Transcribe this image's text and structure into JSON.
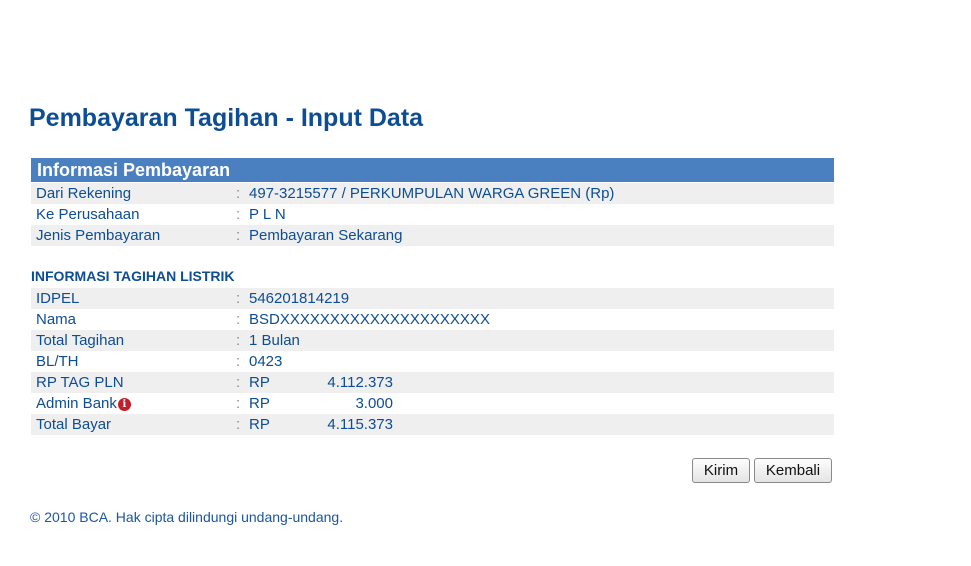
{
  "page_title": "Pembayaran Tagihan - Input Data",
  "payment_info": {
    "heading": "Informasi Pembayaran",
    "rows": [
      {
        "label": "Dari Rekening",
        "colon": ":",
        "value": "497-3215577 / PERKUMPULAN WARGA GREEN (Rp)"
      },
      {
        "label": "Ke Perusahaan",
        "colon": ":",
        "value": "P L N"
      },
      {
        "label": "Jenis Pembayaran",
        "colon": ":",
        "value": "Pembayaran Sekarang"
      }
    ]
  },
  "bill_info": {
    "heading": "INFORMASI TAGIHAN LISTRIK",
    "rows": [
      {
        "label": "IDPEL",
        "colon": ":",
        "value": "546201814219"
      },
      {
        "label": "Nama",
        "colon": ":",
        "value": "BSDXXXXXXXXXXXXXXXXXXXXX"
      },
      {
        "label": "Total Tagihan",
        "colon": ":",
        "value": "1 Bulan"
      },
      {
        "label": "BL/TH",
        "colon": ":",
        "value": "0423"
      }
    ],
    "amount_rows": [
      {
        "label": "RP TAG PLN",
        "colon": ":",
        "currency": "RP",
        "amount": "4.112.373"
      },
      {
        "label": "Admin Bank",
        "colon": ":",
        "currency": "RP",
        "amount": "3.000",
        "info_icon": "i"
      },
      {
        "label": "Total Bayar",
        "colon": ":",
        "currency": "RP",
        "amount": "4.115.373"
      }
    ]
  },
  "buttons": {
    "submit": "Kirim",
    "back": "Kembali"
  },
  "footer": "©  2010 BCA. Hak cipta dilindungi undang-undang.",
  "icons": {
    "admin_bank_info": "info-icon"
  },
  "colors": {
    "title": "#0d4d94",
    "section_header_bg": "#4a7fc0",
    "row_shade": "#efefef",
    "info_icon": "#c0202a"
  }
}
